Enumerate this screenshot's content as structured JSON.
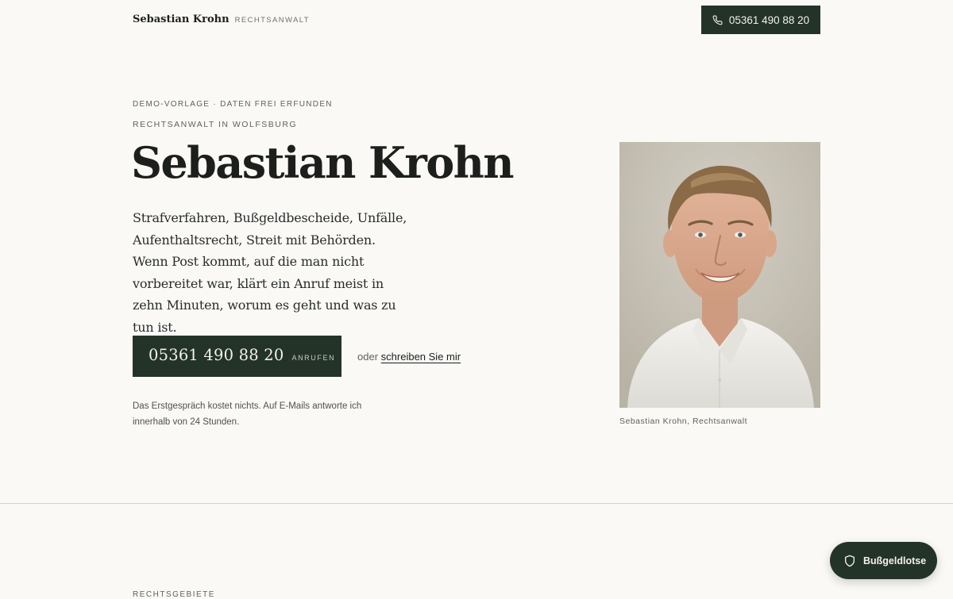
{
  "header": {
    "brand_name": "Sebastian Krohn",
    "brand_sub": "RECHTSANWALT",
    "phone": "05361 490 88 20",
    "phone_icon": "phone-icon"
  },
  "hero": {
    "kicker_demo": "DEMO-VORLAGE · DATEN FREI ERFUNDEN",
    "kicker_location": "RECHTSANWALT IN WOLFSBURG",
    "title": "Sebastian Krohn",
    "lead": "Strafverfahren, Bußgeldbescheide, Unfälle, Aufenthaltsrecht, Streit mit Behörden. Wenn Post kommt, auf die man nicht vorbereitet war, klärt ein Anruf meist in zehn Minuten, worum es geht und was zu tun ist.",
    "cta_number": "05361 490 88 20",
    "cta_label": "ANRUFEN",
    "alt_prefix": "oder",
    "alt_link": "schreiben Sie mir",
    "note": "Das Erstgespräch kostet nichts. Auf E-Mails antworte ich innerhalb von 24 Stunden."
  },
  "portrait": {
    "caption": "Sebastian Krohn, Rechtsanwalt"
  },
  "section": {
    "label": "RECHTSGEBIETE"
  },
  "badge": {
    "label": "Bußgeldlotse",
    "icon": "shield-icon"
  },
  "colors": {
    "background": "#faf9f6",
    "accent": "#243328",
    "text": "#1c1f1c"
  }
}
